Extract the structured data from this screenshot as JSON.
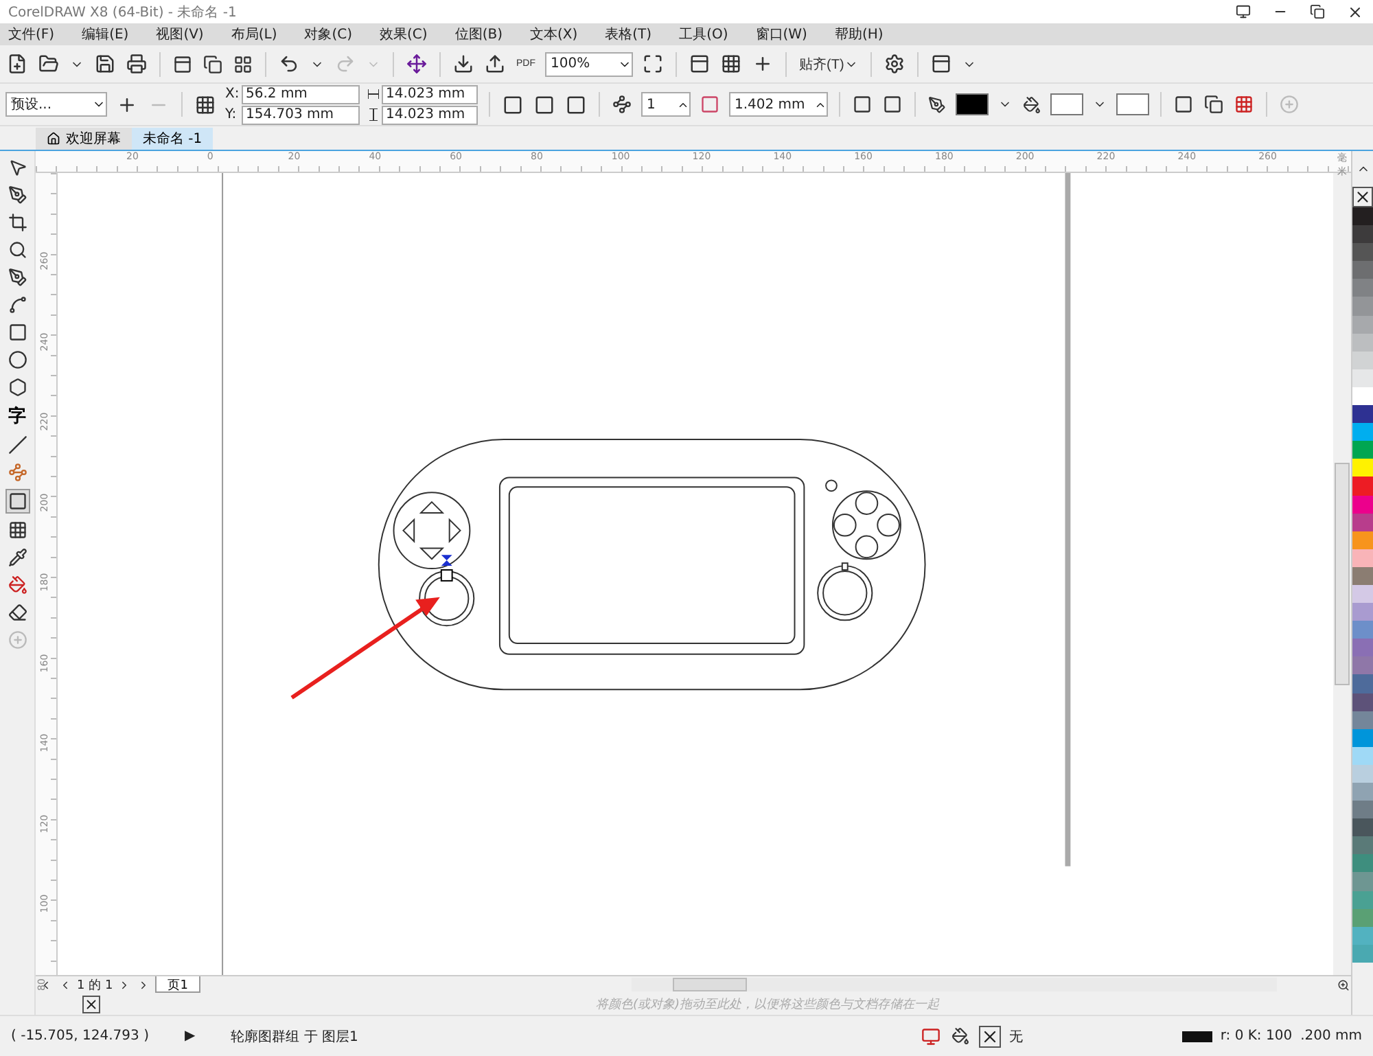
{
  "window": {
    "title": "CorelDRAW X8 (64-Bit) - 未命名 -1"
  },
  "menu": [
    "文件(F)",
    "编辑(E)",
    "视图(V)",
    "布局(L)",
    "对象(C)",
    "效果(C)",
    "位图(B)",
    "文本(X)",
    "表格(T)",
    "工具(O)",
    "窗口(W)",
    "帮助(H)"
  ],
  "toolbar": {
    "pdf_label": "PDF",
    "zoom": "100%",
    "snap": "贴齐(T)"
  },
  "property_bar": {
    "preset": "预设...",
    "x_label": "X:",
    "x": "56.2 mm",
    "y_label": "Y:",
    "y": "154.703 mm",
    "width": "14.023 mm",
    "height": "14.023 mm",
    "steps": "1",
    "offset": "1.402 mm"
  },
  "doc_tabs": [
    {
      "label": "欢迎屏幕",
      "selected": false
    },
    {
      "label": "未命名 -1",
      "selected": true
    }
  ],
  "toolbox": {
    "text_tool": "字"
  },
  "ruler": {
    "h_labels": [
      "20",
      "0",
      "20",
      "40",
      "60",
      "80",
      "100",
      "120",
      "140",
      "160",
      "180",
      "200",
      "220",
      "240",
      "260"
    ],
    "unit": "毫米",
    "v_labels": [
      "260",
      "240",
      "220",
      "200",
      "180",
      "160",
      "140",
      "120",
      "100",
      "80"
    ]
  },
  "page_nav": {
    "text": "1 的 1",
    "page_tab": "页1"
  },
  "palette_hint": "将颜色(或对象)拖动至此处，以便将这些颜色与文档存储在一起",
  "palette": [
    {
      "color": "#231f20"
    },
    {
      "color": "#3d3b3c"
    },
    {
      "color": "#555555"
    },
    {
      "color": "#6d6e70"
    },
    {
      "color": "#808285"
    },
    {
      "color": "#939598"
    },
    {
      "color": "#a7a9ac"
    },
    {
      "color": "#bcbec0"
    },
    {
      "color": "#d1d3d4"
    },
    {
      "color": "#e6e7e8"
    },
    {
      "color": "#ffffff"
    },
    {
      "color": "#2e3192"
    },
    {
      "color": "#00aeef"
    },
    {
      "color": "#00a651"
    },
    {
      "color": "#fff200"
    },
    {
      "color": "#ed1c24"
    },
    {
      "color": "#ec008c"
    },
    {
      "color": "#b83d8c"
    },
    {
      "color": "#f7941d"
    },
    {
      "color": "#f9b4b8"
    },
    {
      "color": "#8b7d72"
    },
    {
      "color": "#d4c9e6"
    },
    {
      "color": "#a99bd0"
    },
    {
      "color": "#6d8fc9"
    },
    {
      "color": "#8a6fb4"
    },
    {
      "color": "#8f77a8"
    },
    {
      "color": "#4e6b9b"
    },
    {
      "color": "#5d5279"
    },
    {
      "color": "#74869a"
    },
    {
      "color": "#0095da"
    },
    {
      "color": "#9fd9f6"
    },
    {
      "color": "#b9cfdf"
    },
    {
      "color": "#8fa3b2"
    },
    {
      "color": "#6f7d87"
    },
    {
      "color": "#4a565c"
    },
    {
      "color": "#5a7a78"
    },
    {
      "color": "#3e8e7e"
    },
    {
      "color": "#6e9692"
    },
    {
      "color": "#4aa193"
    },
    {
      "color": "#5aa074"
    },
    {
      "color": "#52b2c0"
    },
    {
      "color": "#4aa9b1"
    }
  ],
  "status_bar": {
    "coords": "( -15.705, 124.793 )",
    "arrow": "▶",
    "selection": "轮廓图群组 于 图层1",
    "fill": "无",
    "outline_color": "r: 0 K: 100",
    "outline_width": ".200 mm"
  }
}
